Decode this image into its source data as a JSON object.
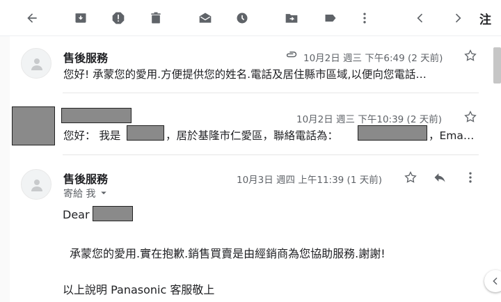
{
  "toolbar": {
    "icons": [
      "back-arrow-icon",
      "archive-icon",
      "report-spam-icon",
      "delete-icon",
      "mark-unread-icon",
      "snooze-icon",
      "move-to-icon",
      "label-icon",
      "more-vert-icon",
      "chevron-left-icon",
      "chevron-right-icon"
    ],
    "lang_label": "注"
  },
  "messages": [
    {
      "sender": "售後服務",
      "date": "10月2日 週三 下午6:49 (2 天前)",
      "snippet": "您好! 承蒙您的愛用.方便提供您的姓名.電話及居住縣市區域,以便向您電話…",
      "has_attachment": true
    },
    {
      "sender": "",
      "date": "10月2日 週三 下午10:39 (2 天前)",
      "snippet_prefix": "您好： 我是",
      "snippet_middle": "，居於基隆市仁愛區，聯絡電話為：",
      "snippet_suffix": "，Ema…"
    },
    {
      "sender": "售後服務",
      "recipient": "寄給 我",
      "date": "10月3日 週四 上午11:39 (1 天前)",
      "greeting": "Dear",
      "line1": "承蒙您的愛用.實在抱歉.銷售買賣是由經銷商為您協助服務.謝謝!",
      "line2": "以上說明  Panasonic  客服敬上"
    }
  ],
  "colors": {
    "icon": "#5f6368",
    "redact": "#8a8a8a"
  }
}
